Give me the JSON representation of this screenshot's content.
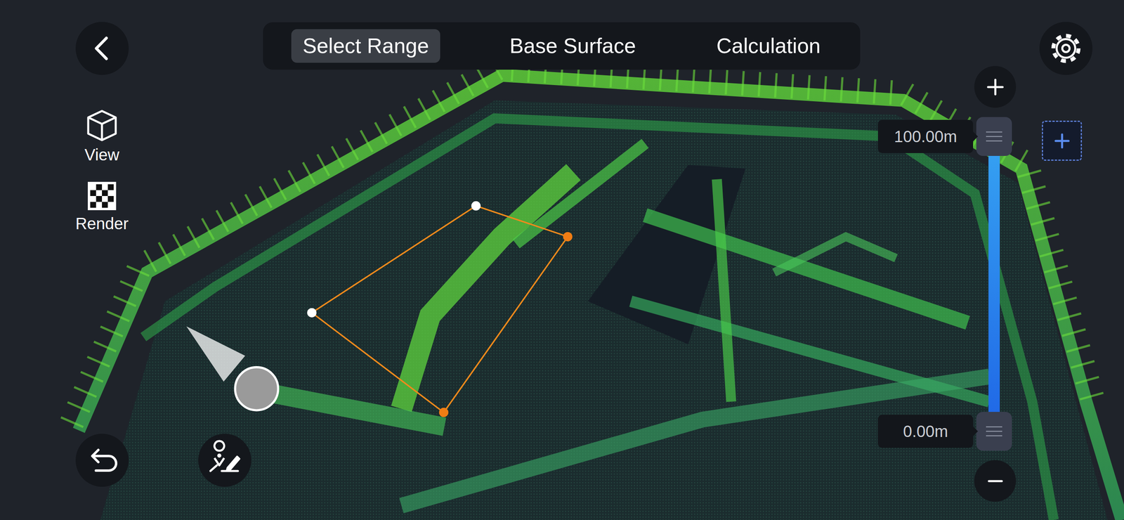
{
  "tabs": [
    {
      "label": "Select Range",
      "selected": true
    },
    {
      "label": "Base Surface",
      "selected": false
    },
    {
      "label": "Calculation",
      "selected": false
    }
  ],
  "tools": [
    {
      "label": "View"
    },
    {
      "label": "Render"
    }
  ],
  "height_range": {
    "upper": {
      "reading": "100.00m",
      "level": 1
    },
    "lower": {
      "reading": "0.00m",
      "level": 0
    }
  },
  "selection": {
    "vertices": [
      {
        "color": "#ffffff"
      },
      {
        "color": "#f07d14"
      },
      {
        "color": "#f07d14"
      },
      {
        "color": "#ffffff"
      }
    ]
  }
}
